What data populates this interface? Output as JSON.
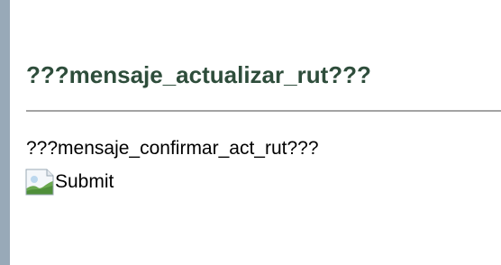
{
  "page": {
    "heading": "???mensaje_actualizar_rut???",
    "message": "???mensaje_confirmar_act_rut???",
    "submit_alt": "Submit",
    "submit_icon": "broken-image-icon"
  },
  "colors": {
    "left_bar": "#98a9b8",
    "heading": "#2e4d3b",
    "divider": "#a3a3a3"
  }
}
